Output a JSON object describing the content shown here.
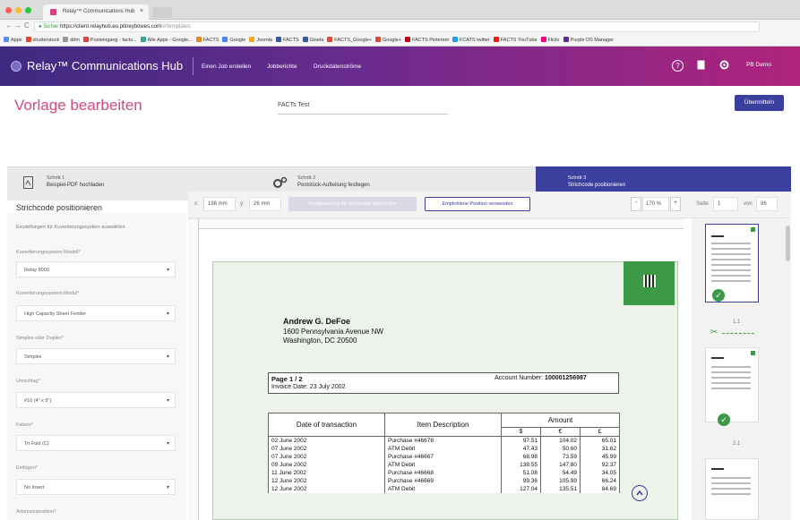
{
  "browser": {
    "tab_title": "Relay™ Communications Hub",
    "tab_close": "×",
    "nav_back": "←",
    "nav_forward": "→",
    "nav_reload": "C",
    "url_secure": "Sicher",
    "url_host": "https://client.relayhub.eu.pitneybowes.com",
    "url_path": "/#/templates",
    "bookmarks": [
      {
        "label": "Apps",
        "color": "#5b8def"
      },
      {
        "label": "shutterstock",
        "color": "#e04b2a"
      },
      {
        "label": "ddm",
        "color": "#999999"
      },
      {
        "label": "Posteingang - facts...",
        "color": "#d44"
      },
      {
        "label": "Alle Apps - Google...",
        "color": "#3a9"
      },
      {
        "label": "FACTS",
        "color": "#e6881c"
      },
      {
        "label": "Google",
        "color": "#4285f4"
      },
      {
        "label": "Joomla",
        "color": "#f4a623"
      },
      {
        "label": "FACTS",
        "color": "#3b5998"
      },
      {
        "label": "Gisela",
        "color": "#3b5998"
      },
      {
        "label": "FACTS_Google+",
        "color": "#dd4b39"
      },
      {
        "label": "Google+",
        "color": "#dd4b39"
      },
      {
        "label": "FACTS Pinterest",
        "color": "#bd081c"
      },
      {
        "label": "FCATS twitter",
        "color": "#1da1f2"
      },
      {
        "label": "FACTS YouTube",
        "color": "#e62117"
      },
      {
        "label": "Flickr",
        "color": "#ff0084"
      },
      {
        "label": "Purple DS Manager",
        "color": "#5b2d90"
      }
    ]
  },
  "header": {
    "app_title": "Relay™ Communications Hub",
    "nav": [
      "Einen Job erstellen",
      "Jobberichte",
      "Druckdatenströme"
    ],
    "help_icon": "?",
    "user": "PB Demo"
  },
  "title_row": {
    "page_title": "Vorlage bearbeiten",
    "doc_name": "FACTs Test",
    "submit": "Übermitteln"
  },
  "steps": [
    {
      "num": "Schritt 1",
      "label": "Beispiel-PDF hochladen"
    },
    {
      "num": "Schritt 2",
      "label": "Poststück-Aufteilung festlegen"
    },
    {
      "num": "Schritt 3",
      "label": "Strichcode positionieren"
    }
  ],
  "left_panel": {
    "title": "Strichcode positionieren",
    "subtitle": "Einstellungen für Kuvertierungssystem auswählen",
    "fields": [
      {
        "label": "Kuvertierungssystem-Modell*",
        "value": "Relay 8000"
      },
      {
        "label": "Kuvertierungssystem-Modul*",
        "value": "High Capacity Sheet Feeder"
      },
      {
        "label": "Simplex oder Duplex*",
        "value": "Simplex"
      },
      {
        "label": "Umschlag*",
        "value": "#10 (4\" x 9\")"
      },
      {
        "label": "Falzen*",
        "value": "Tri Fold (C)"
      },
      {
        "label": "Einfügen*",
        "value": "No Insert"
      },
      {
        "label": "Adressenposition*",
        "value": ""
      }
    ]
  },
  "toolbar": {
    "x_label": "x:",
    "x_value": "198 mm",
    "y_label": "y:",
    "y_value": "26 mm",
    "check_button": "Positionierung für Strichcode überprüfen",
    "recommend_button": "Empfohlene Position verwenden",
    "zoom_minus": "-",
    "zoom_value": "170 %",
    "zoom_plus": "+",
    "page_label": "Seite",
    "page_value": "1",
    "of_label": "von",
    "page_total": "96"
  },
  "document": {
    "name": "Andrew G. DeFoe",
    "address1": "1600 Pennsylvania Avenue NW",
    "address2": "Washington, DC 20500",
    "page": "Page 1 / 2",
    "invoice_date": "Invoice Date: 23 July 2002",
    "account_label": "Account Number:",
    "account_number": "100001256987",
    "table_headers": [
      "Date of transaction",
      "Item Description",
      "Amount"
    ],
    "currency_headers": [
      "$",
      "€",
      "£"
    ],
    "rows": [
      [
        "02 June 2002",
        "Purchase #46678",
        "97.51",
        "104.02",
        "65.01"
      ],
      [
        "07 June 2002",
        "ATM Debit",
        "47.43",
        "50.60",
        "31.62"
      ],
      [
        "07 June 2002",
        "Purchase #46667",
        "68.98",
        "73.59",
        "45.99"
      ],
      [
        "09 June 2002",
        "ATM Debit",
        "138.55",
        "147.80",
        "92.37"
      ],
      [
        "11 June 2002",
        "Purchase #46668",
        "51.08",
        "54.49",
        "34.05"
      ],
      [
        "12 June 2002",
        "Purchase #46669",
        "99.36",
        "105.99",
        "66.24"
      ],
      [
        "12 June 2002",
        "ATM Debit",
        "127.04",
        "135.51",
        "84.69"
      ]
    ]
  },
  "thumbnails": {
    "labels": [
      "1.1",
      "2.1"
    ],
    "check": "✓",
    "scissors": "✂"
  },
  "colors": {
    "accent": "#3b3f9e",
    "title_pink": "#d24a7e",
    "success": "#3c9a46"
  }
}
